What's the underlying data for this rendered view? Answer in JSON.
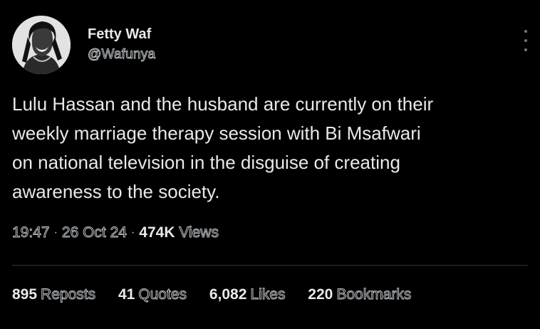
{
  "author": {
    "name": "Fetty Waf",
    "handle": "@Wafunya"
  },
  "tweet": {
    "text": "Lulu Hassan and the husband are currently on their\nweekly marriage therapy session with Bi Msafwari\non national television in the disguise of creating\nawareness to the society."
  },
  "meta": {
    "time": "19:47",
    "date": "26 Oct 24",
    "views_count": "474K",
    "views_label": "Views",
    "separator": "·"
  },
  "stats": [
    {
      "count": "895",
      "label": "Reposts"
    },
    {
      "count": "41",
      "label": "Quotes"
    },
    {
      "count": "6,082",
      "label": "Likes"
    },
    {
      "count": "220",
      "label": "Bookmarks"
    }
  ],
  "icons": {
    "more": "more-vertical-icon"
  },
  "colors": {
    "background": "#000000",
    "text": "#e7e9ea",
    "secondary": "#71767b",
    "divider": "#2f3336"
  }
}
